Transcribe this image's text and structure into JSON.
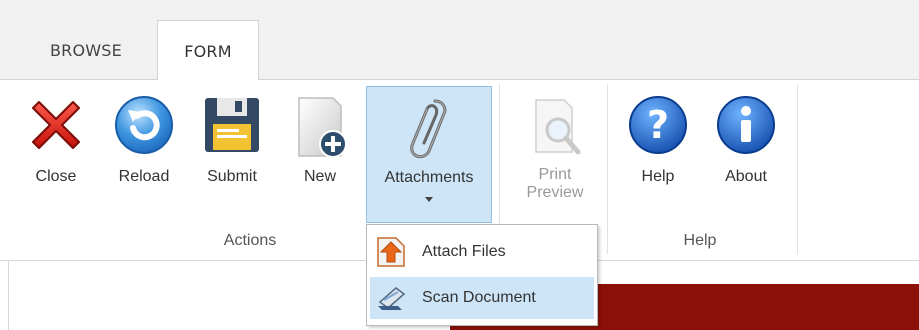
{
  "tabs": [
    {
      "label": "BROWSE",
      "active": false
    },
    {
      "label": "FORM",
      "active": true
    }
  ],
  "ribbon": {
    "commands": {
      "close": "Close",
      "reload": "Reload",
      "submit": "Submit",
      "new": "New",
      "attachments": "Attachments",
      "print_preview_line1": "Print",
      "print_preview_line2": "Preview",
      "help": "Help",
      "about": "About"
    },
    "groups": {
      "actions": "Actions",
      "help": "Help"
    }
  },
  "attachments_menu": {
    "items": [
      {
        "label": "Attach Files",
        "icon": "attach-files-icon"
      },
      {
        "label": "Scan Document",
        "icon": "scan-document-icon",
        "highlighted": true
      }
    ]
  },
  "colors": {
    "accent_blue": "#cde5f7",
    "content_bar": "#8b1008"
  }
}
